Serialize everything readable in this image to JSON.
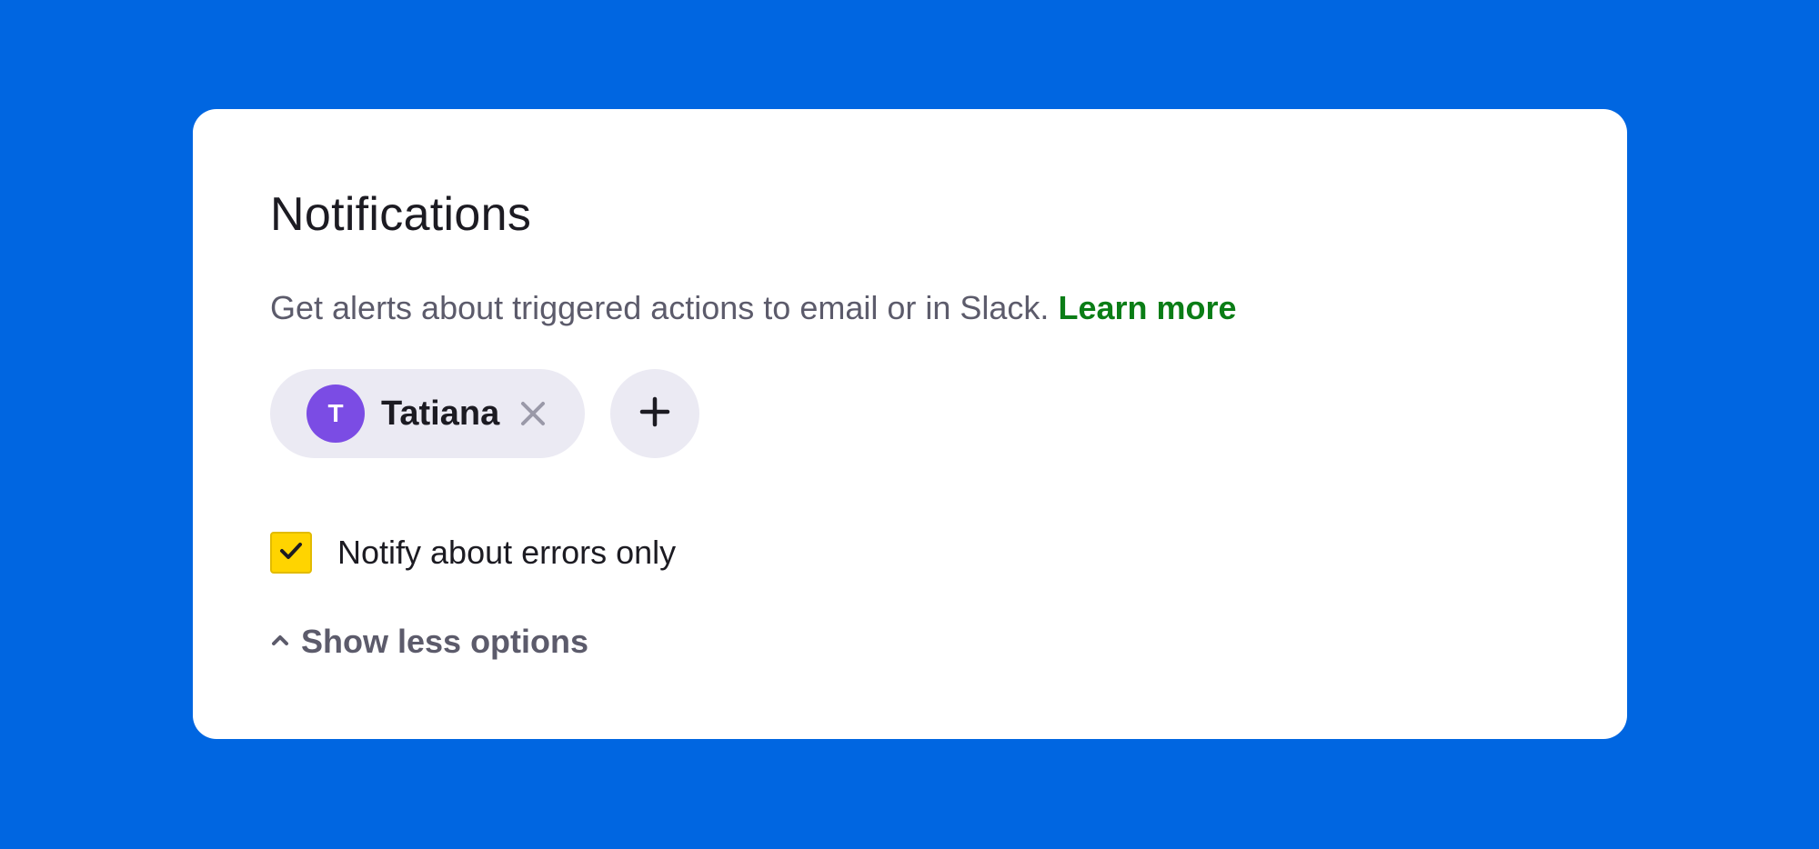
{
  "card": {
    "title": "Notifications",
    "description": "Get alerts about triggered actions to email or in Slack.",
    "learn_more_label": "Learn more"
  },
  "recipients": [
    {
      "initial": "T",
      "name": "Tatiana",
      "avatar_color": "#7B4CE4"
    }
  ],
  "add_recipient_icon": "plus-icon",
  "remove_recipient_icon": "close-icon",
  "errors_only": {
    "label": "Notify about errors only",
    "checked": true,
    "checkbox_color": "#FFD400"
  },
  "toggle": {
    "label": "Show less options",
    "icon": "chevron-up-icon"
  },
  "colors": {
    "background": "#0066E1",
    "link": "#0A7D16",
    "chip": "#EBEAF3"
  }
}
